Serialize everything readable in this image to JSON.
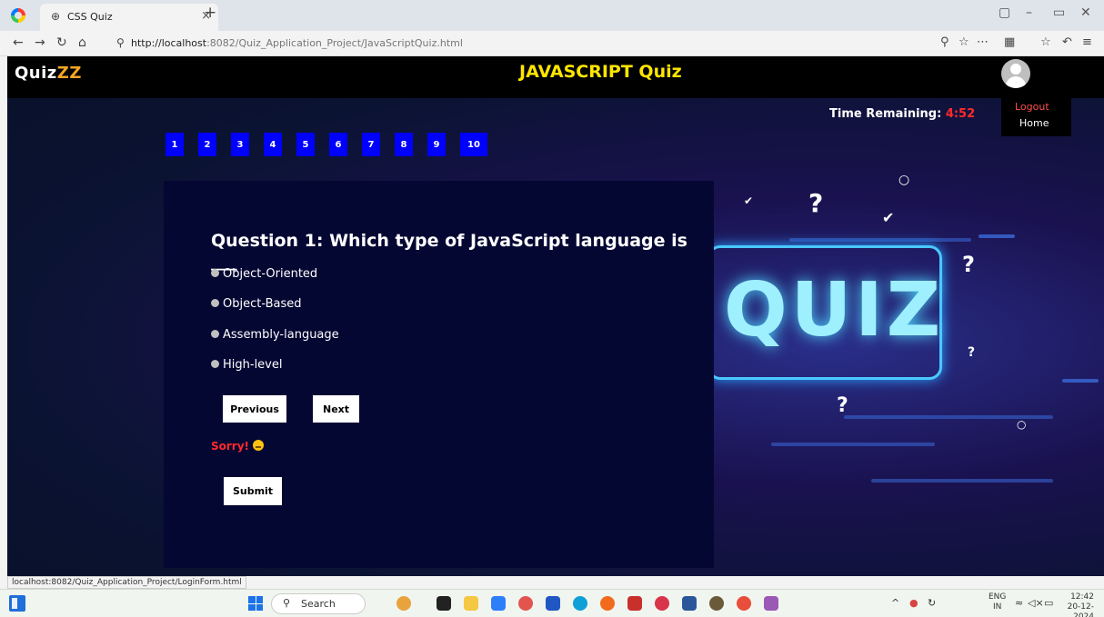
{
  "browser": {
    "tab_title": "CSS Quiz",
    "url_host": "http://localhost",
    "url_path": ":8082/Quiz_Application_Project/JavaScriptQuiz.html",
    "status_url": "localhost:8082/Quiz_Application_Project/LoginForm.html"
  },
  "header": {
    "brand_a": "Quiz",
    "brand_b": "ZZ",
    "title": "JAVASCRIPT Quiz"
  },
  "user_menu": {
    "logout": "Logout",
    "home": "Home"
  },
  "timer": {
    "label": "Time Remaining: ",
    "value": "4:52"
  },
  "question_nav": [
    "1",
    "2",
    "3",
    "4",
    "5",
    "6",
    "7",
    "8",
    "9",
    "10"
  ],
  "question": {
    "text": "Question 1: Which type of JavaScript language is ___",
    "options": [
      "Object-Oriented",
      "Object-Based",
      "Assembly-language",
      "High-level"
    ]
  },
  "buttons": {
    "previous": "Previous",
    "next": "Next",
    "submit": "Submit"
  },
  "feedback": {
    "text": "Sorry!"
  },
  "background": {
    "headline": "QUIZ"
  },
  "taskbar": {
    "search_label": "Search",
    "lang_line1": "ENG",
    "lang_line2": "IN",
    "time": "12:42",
    "date": "20-12-2024"
  }
}
